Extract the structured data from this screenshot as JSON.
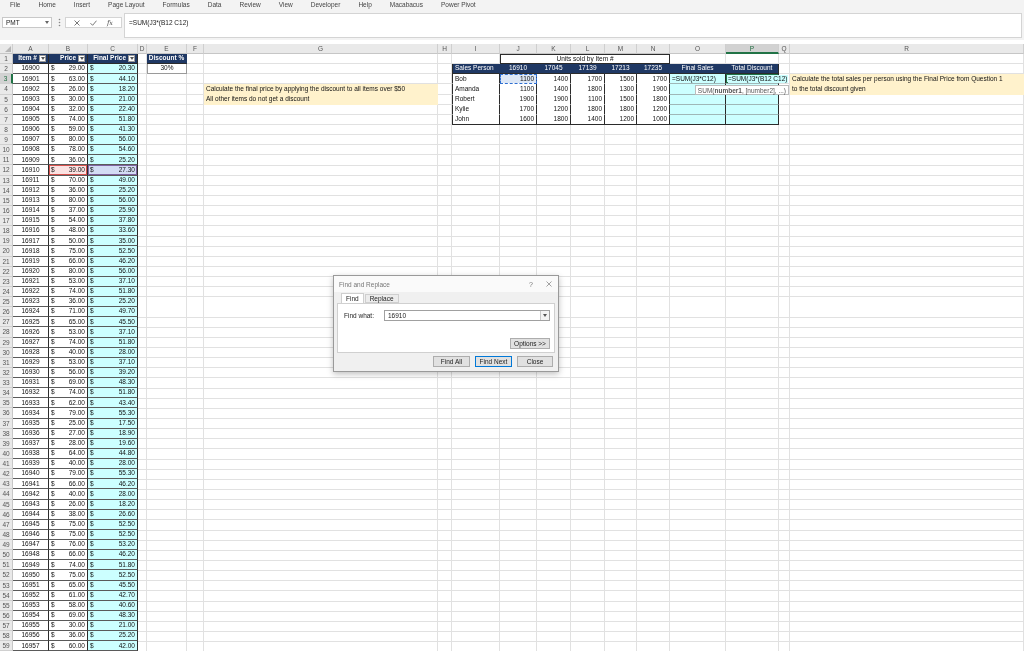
{
  "ribbon": {
    "tabs": [
      {
        "label": "File",
        "selected": false
      },
      {
        "label": "Home",
        "selected": false
      },
      {
        "label": "Insert",
        "selected": false
      },
      {
        "label": "Page Layout",
        "selected": false
      },
      {
        "label": "Formulas",
        "selected": false
      },
      {
        "label": "Data",
        "selected": false
      },
      {
        "label": "Review",
        "selected": false
      },
      {
        "label": "View",
        "selected": false
      },
      {
        "label": "Developer",
        "selected": false
      },
      {
        "label": "Help",
        "selected": false
      },
      {
        "label": "Macabacus",
        "selected": false
      },
      {
        "label": "Power Pivot",
        "selected": false
      }
    ]
  },
  "formula_bar": {
    "name_box": "PMT",
    "function_label": "fx",
    "formula": "=SUM(J3*(B12 C12)"
  },
  "sheet": {
    "column_headers": [
      {
        "label": "A",
        "selected": false
      },
      {
        "label": "B",
        "selected": false
      },
      {
        "label": "C",
        "selected": false
      },
      {
        "label": "D",
        "selected": false
      },
      {
        "label": "E",
        "selected": false
      },
      {
        "label": "F",
        "selected": false
      },
      {
        "label": "G",
        "selected": false
      },
      {
        "label": "H",
        "selected": false
      },
      {
        "label": "I",
        "selected": false
      },
      {
        "label": "J",
        "selected": false
      },
      {
        "label": "K",
        "selected": false
      },
      {
        "label": "L",
        "selected": false
      },
      {
        "label": "M",
        "selected": false
      },
      {
        "label": "N",
        "selected": false
      },
      {
        "label": "O",
        "selected": false
      },
      {
        "label": "P",
        "selected": true
      },
      {
        "label": "Q",
        "selected": false
      },
      {
        "label": "R",
        "selected": false
      }
    ],
    "row_headers": [
      {
        "label": "1",
        "selected": false
      },
      {
        "label": "2",
        "selected": false
      },
      {
        "label": "3",
        "selected": true
      },
      {
        "label": "4",
        "selected": false
      },
      {
        "label": "5",
        "selected": false
      },
      {
        "label": "6",
        "selected": false
      },
      {
        "label": "7",
        "selected": false
      },
      {
        "label": "8",
        "selected": false
      },
      {
        "label": "9",
        "selected": false
      },
      {
        "label": "10",
        "selected": false
      },
      {
        "label": "11",
        "selected": false
      },
      {
        "label": "12",
        "selected": false
      },
      {
        "label": "13",
        "selected": false
      },
      {
        "label": "14",
        "selected": false
      },
      {
        "label": "15",
        "selected": false
      },
      {
        "label": "16",
        "selected": false
      },
      {
        "label": "17",
        "selected": false
      },
      {
        "label": "18",
        "selected": false
      },
      {
        "label": "19",
        "selected": false
      },
      {
        "label": "20",
        "selected": false
      },
      {
        "label": "21",
        "selected": false
      },
      {
        "label": "22",
        "selected": false
      },
      {
        "label": "23",
        "selected": false
      },
      {
        "label": "24",
        "selected": false
      },
      {
        "label": "25",
        "selected": false
      },
      {
        "label": "26",
        "selected": false
      },
      {
        "label": "27",
        "selected": false
      },
      {
        "label": "28",
        "selected": false
      },
      {
        "label": "29",
        "selected": false
      },
      {
        "label": "30",
        "selected": false
      },
      {
        "label": "31",
        "selected": false
      },
      {
        "label": "32",
        "selected": false
      },
      {
        "label": "33",
        "selected": false
      },
      {
        "label": "34",
        "selected": false
      },
      {
        "label": "35",
        "selected": false
      },
      {
        "label": "36",
        "selected": false
      },
      {
        "label": "37",
        "selected": false
      },
      {
        "label": "38",
        "selected": false
      },
      {
        "label": "39",
        "selected": false
      },
      {
        "label": "40",
        "selected": false
      },
      {
        "label": "41",
        "selected": false
      },
      {
        "label": "42",
        "selected": false
      },
      {
        "label": "43",
        "selected": false
      },
      {
        "label": "44",
        "selected": false
      },
      {
        "label": "45",
        "selected": false
      },
      {
        "label": "46",
        "selected": false
      },
      {
        "label": "47",
        "selected": false
      },
      {
        "label": "48",
        "selected": false
      },
      {
        "label": "49",
        "selected": false
      },
      {
        "label": "50",
        "selected": false
      },
      {
        "label": "51",
        "selected": false
      },
      {
        "label": "52",
        "selected": false
      },
      {
        "label": "53",
        "selected": false
      },
      {
        "label": "54",
        "selected": false
      },
      {
        "label": "55",
        "selected": false
      },
      {
        "label": "56",
        "selected": false
      },
      {
        "label": "57",
        "selected": false
      },
      {
        "label": "58",
        "selected": false
      },
      {
        "label": "59",
        "selected": false
      }
    ],
    "items_table": {
      "columns": [
        {
          "label": "Item #",
          "filter": true
        },
        {
          "label": "Price",
          "filter": true
        },
        {
          "label": "Final Price",
          "filter": true
        }
      ],
      "rows": [
        {
          "cells": [
            "16900",
            "$",
            "29.00",
            "$",
            "20.30"
          ],
          "referenced": false
        },
        {
          "cells": [
            "16901",
            "$",
            "63.00",
            "$",
            "44.10"
          ],
          "referenced": false
        },
        {
          "cells": [
            "16902",
            "$",
            "26.00",
            "$",
            "18.20"
          ],
          "referenced": false
        },
        {
          "cells": [
            "16903",
            "$",
            "30.00",
            "$",
            "21.00"
          ],
          "referenced": false
        },
        {
          "cells": [
            "16904",
            "$",
            "32.00",
            "$",
            "22.40"
          ],
          "referenced": false
        },
        {
          "cells": [
            "16905",
            "$",
            "74.00",
            "$",
            "51.80"
          ],
          "referenced": false
        },
        {
          "cells": [
            "16906",
            "$",
            "59.00",
            "$",
            "41.30"
          ],
          "referenced": false
        },
        {
          "cells": [
            "16907",
            "$",
            "80.00",
            "$",
            "56.00"
          ],
          "referenced": false
        },
        {
          "cells": [
            "16908",
            "$",
            "78.00",
            "$",
            "54.60"
          ],
          "referenced": false
        },
        {
          "cells": [
            "16909",
            "$",
            "36.00",
            "$",
            "25.20"
          ],
          "referenced": false
        },
        {
          "cells": [
            "16910",
            "$",
            "39.00",
            "$",
            "27.30"
          ],
          "referenced": true
        },
        {
          "cells": [
            "16911",
            "$",
            "70.00",
            "$",
            "49.00"
          ],
          "referenced": false
        },
        {
          "cells": [
            "16912",
            "$",
            "36.00",
            "$",
            "25.20"
          ],
          "referenced": false
        },
        {
          "cells": [
            "16913",
            "$",
            "80.00",
            "$",
            "56.00"
          ],
          "referenced": false
        },
        {
          "cells": [
            "16914",
            "$",
            "37.00",
            "$",
            "25.90"
          ],
          "referenced": false
        },
        {
          "cells": [
            "16915",
            "$",
            "54.00",
            "$",
            "37.80"
          ],
          "referenced": false
        },
        {
          "cells": [
            "16916",
            "$",
            "48.00",
            "$",
            "33.60"
          ],
          "referenced": false
        },
        {
          "cells": [
            "16917",
            "$",
            "50.00",
            "$",
            "35.00"
          ],
          "referenced": false
        },
        {
          "cells": [
            "16918",
            "$",
            "75.00",
            "$",
            "52.50"
          ],
          "referenced": false
        },
        {
          "cells": [
            "16919",
            "$",
            "66.00",
            "$",
            "46.20"
          ],
          "referenced": false
        },
        {
          "cells": [
            "16920",
            "$",
            "80.00",
            "$",
            "56.00"
          ],
          "referenced": false
        },
        {
          "cells": [
            "16921",
            "$",
            "53.00",
            "$",
            "37.10"
          ],
          "referenced": false
        },
        {
          "cells": [
            "16922",
            "$",
            "74.00",
            "$",
            "51.80"
          ],
          "referenced": false
        },
        {
          "cells": [
            "16923",
            "$",
            "36.00",
            "$",
            "25.20"
          ],
          "referenced": false
        },
        {
          "cells": [
            "16924",
            "$",
            "71.00",
            "$",
            "49.70"
          ],
          "referenced": false
        },
        {
          "cells": [
            "16925",
            "$",
            "65.00",
            "$",
            "45.50"
          ],
          "referenced": false
        },
        {
          "cells": [
            "16926",
            "$",
            "53.00",
            "$",
            "37.10"
          ],
          "referenced": false
        },
        {
          "cells": [
            "16927",
            "$",
            "74.00",
            "$",
            "51.80"
          ],
          "referenced": false
        },
        {
          "cells": [
            "16928",
            "$",
            "40.00",
            "$",
            "28.00"
          ],
          "referenced": false
        },
        {
          "cells": [
            "16929",
            "$",
            "53.00",
            "$",
            "37.10"
          ],
          "referenced": false
        },
        {
          "cells": [
            "16930",
            "$",
            "56.00",
            "$",
            "39.20"
          ],
          "referenced": false
        },
        {
          "cells": [
            "16931",
            "$",
            "69.00",
            "$",
            "48.30"
          ],
          "referenced": false
        },
        {
          "cells": [
            "16932",
            "$",
            "74.00",
            "$",
            "51.80"
          ],
          "referenced": false
        },
        {
          "cells": [
            "16933",
            "$",
            "62.00",
            "$",
            "43.40"
          ],
          "referenced": false
        },
        {
          "cells": [
            "16934",
            "$",
            "79.00",
            "$",
            "55.30"
          ],
          "referenced": false
        },
        {
          "cells": [
            "16935",
            "$",
            "25.00",
            "$",
            "17.50"
          ],
          "referenced": false
        },
        {
          "cells": [
            "16936",
            "$",
            "27.00",
            "$",
            "18.90"
          ],
          "referenced": false
        },
        {
          "cells": [
            "16937",
            "$",
            "28.00",
            "$",
            "19.60"
          ],
          "referenced": false
        },
        {
          "cells": [
            "16938",
            "$",
            "64.00",
            "$",
            "44.80"
          ],
          "referenced": false
        },
        {
          "cells": [
            "16939",
            "$",
            "40.00",
            "$",
            "28.00"
          ],
          "referenced": false
        },
        {
          "cells": [
            "16940",
            "$",
            "79.00",
            "$",
            "55.30"
          ],
          "referenced": false
        },
        {
          "cells": [
            "16941",
            "$",
            "66.00",
            "$",
            "46.20"
          ],
          "referenced": false
        },
        {
          "cells": [
            "16942",
            "$",
            "40.00",
            "$",
            "28.00"
          ],
          "referenced": false
        },
        {
          "cells": [
            "16943",
            "$",
            "26.00",
            "$",
            "18.20"
          ],
          "referenced": false
        },
        {
          "cells": [
            "16944",
            "$",
            "38.00",
            "$",
            "26.60"
          ],
          "referenced": false
        },
        {
          "cells": [
            "16945",
            "$",
            "75.00",
            "$",
            "52.50"
          ],
          "referenced": false
        },
        {
          "cells": [
            "16946",
            "$",
            "75.00",
            "$",
            "52.50"
          ],
          "referenced": false
        },
        {
          "cells": [
            "16947",
            "$",
            "76.00",
            "$",
            "53.20"
          ],
          "referenced": false
        },
        {
          "cells": [
            "16948",
            "$",
            "66.00",
            "$",
            "46.20"
          ],
          "referenced": false
        },
        {
          "cells": [
            "16949",
            "$",
            "74.00",
            "$",
            "51.80"
          ],
          "referenced": false
        },
        {
          "cells": [
            "16950",
            "$",
            "75.00",
            "$",
            "52.50"
          ],
          "referenced": false
        },
        {
          "cells": [
            "16951",
            "$",
            "65.00",
            "$",
            "45.50"
          ],
          "referenced": false
        },
        {
          "cells": [
            "16952",
            "$",
            "61.00",
            "$",
            "42.70"
          ],
          "referenced": false
        },
        {
          "cells": [
            "16953",
            "$",
            "58.00",
            "$",
            "40.60"
          ],
          "referenced": false
        },
        {
          "cells": [
            "16954",
            "$",
            "69.00",
            "$",
            "48.30"
          ],
          "referenced": false
        },
        {
          "cells": [
            "16955",
            "$",
            "30.00",
            "$",
            "21.00"
          ],
          "referenced": false
        },
        {
          "cells": [
            "16956",
            "$",
            "36.00",
            "$",
            "25.20"
          ],
          "referenced": false
        },
        {
          "cells": [
            "16957",
            "$",
            "60.00",
            "$",
            "42.00"
          ],
          "referenced": false
        }
      ]
    },
    "discount": {
      "label": "Discount %",
      "value": "30%"
    },
    "price_note": [
      "Calculate the final price by applying the discount to all items over $50",
      "All other items do not get a discount"
    ],
    "sales_table": {
      "group_label": "Units sold by Item #",
      "columns": [
        "Sales Person",
        "16910",
        "17045",
        "17139",
        "17213",
        "17235",
        "Final Sales",
        "Total Discount"
      ],
      "rows": [
        {
          "name": "Bob",
          "units": [
            "1100",
            "1400",
            "1700",
            "1500",
            "1700"
          ],
          "final_sales": "=SUM(J3*C12)",
          "total_discount": "=SUM(J3*(B12 C12)",
          "referenced": true
        },
        {
          "name": "Amanda",
          "units": [
            "1100",
            "1400",
            "1800",
            "1300",
            "1900"
          ],
          "referenced": false
        },
        {
          "name": "Robert",
          "units": [
            "1900",
            "1900",
            "1100",
            "1500",
            "1800"
          ],
          "referenced": false
        },
        {
          "name": "Kylie",
          "units": [
            "1700",
            "1200",
            "1800",
            "1800",
            "1200"
          ],
          "referenced": false
        },
        {
          "name": "John",
          "units": [
            "1600",
            "1800",
            "1400",
            "1200",
            "1000"
          ],
          "referenced": false
        }
      ]
    },
    "sales_note": [
      "Calculate the total sales per person using the Final Price from Question 1",
      "to the total discount given"
    ],
    "function_tooltip": "SUM(**number1**, [number2], ...)"
  },
  "dialog": {
    "title": "Find and Replace",
    "help": "?",
    "tabs": [
      {
        "label": "Find",
        "selected": true
      },
      {
        "label": "Replace",
        "selected": false
      }
    ],
    "find_label": "Find what:",
    "find_value": "16910",
    "options_button": "Options >>",
    "buttons": [
      {
        "label": "Find All",
        "default": false
      },
      {
        "label": "Find Next",
        "default": true
      },
      {
        "label": "Close",
        "default": false
      }
    ]
  }
}
